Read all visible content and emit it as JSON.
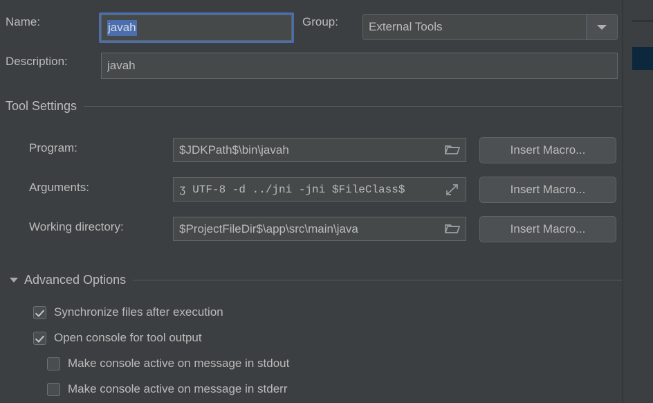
{
  "form": {
    "name": {
      "label": "Name:",
      "value": "javah",
      "selected_text": "javah",
      "selection_color": "#4b6eaf",
      "focus_border_color": "#4b6eaf"
    },
    "group": {
      "label": "Group:",
      "value": "External Tools",
      "arrow_icon": "chevron-down-icon"
    },
    "description": {
      "label": "Description:",
      "value": "javah"
    }
  },
  "tool_settings": {
    "title": "Tool Settings",
    "rows": [
      {
        "label": "Program:",
        "value": "$JDKPath$\\bin\\javah",
        "field_icon": "folder-icon",
        "button": "Insert Macro...",
        "mono": false
      },
      {
        "label": "Arguments:",
        "value": "ʒ UTF-8 -d ../jni -jni $FileClass$",
        "field_icon": "expand-icon",
        "button": "Insert Macro...",
        "mono": true
      },
      {
        "label": "Working directory:",
        "value": "$ProjectFileDir$\\app\\src\\main\\java",
        "field_icon": "folder-icon",
        "button": "Insert Macro...",
        "mono": false
      }
    ]
  },
  "advanced_options": {
    "title": "Advanced Options",
    "expanded": true,
    "toggle_icon": "triangle-down-icon",
    "checkboxes": [
      {
        "label": "Synchronize files after execution",
        "checked": true,
        "indent": 0
      },
      {
        "label": "Open console for tool output",
        "checked": true,
        "indent": 0
      },
      {
        "label": "Make console active on message in stdout",
        "checked": false,
        "indent": 1
      },
      {
        "label": "Make console active on message in stderr",
        "checked": false,
        "indent": 1
      }
    ]
  },
  "side_panel": {
    "selected_row_color": "#0d273d"
  },
  "theme": {
    "background": "#3c3f41",
    "field_background": "#45494a",
    "text": "#bbbbbb",
    "button_background": "#4c5052"
  }
}
